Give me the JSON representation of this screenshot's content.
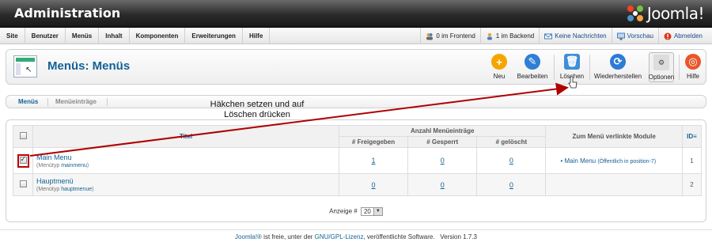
{
  "header": {
    "title": "Administration",
    "brand": "Joomla!"
  },
  "menubar": {
    "items": [
      "Site",
      "Benutzer",
      "Menüs",
      "Inhalt",
      "Komponenten",
      "Erweiterungen",
      "Hilfe"
    ],
    "status": {
      "frontend": "0 im Frontend",
      "backend": "1 im Backend",
      "messages": "Keine Nachrichten",
      "preview": "Vorschau",
      "logout": "Abmelden"
    }
  },
  "toolbar": {
    "page_title": "Menüs: Menüs",
    "buttons": {
      "new": "Neu",
      "edit": "Bearbeiten",
      "delete": "Löschen",
      "restore": "Wiederherstellen",
      "options": "Optionen",
      "help": "Hilfe"
    }
  },
  "submenu": {
    "tab_menus": "Menüs",
    "tab_items": "Menüeinträge"
  },
  "annotation": {
    "line1": "Häkchen setzen und auf",
    "line2": "Löschen drücken"
  },
  "table": {
    "headers": {
      "title": "Titel",
      "count_group": "Anzahl Menüeinträge",
      "published": "# Freigegeben",
      "unpublished": "# Gesperrt",
      "trashed": "# gelöscht",
      "modules": "Zum Menü verlinkte Module",
      "id": "ID"
    },
    "rows": [
      {
        "title": "Main Menu",
        "type_label": "(Menütyp",
        "type": "mainmenu",
        "published": "1",
        "unpublished": "0",
        "trashed": "0",
        "module": "Main Menu",
        "module_detail": "(Öffentlich in position-7)",
        "id": "1",
        "checked": true
      },
      {
        "title": "Hauptmenü",
        "type_label": "(Menütyp",
        "type": "hauptmenue",
        "published": "0",
        "unpublished": "0",
        "trashed": "0",
        "module": "",
        "module_detail": "",
        "id": "2",
        "checked": false
      }
    ],
    "pagination": {
      "label": "Anzeige #",
      "value": "20"
    }
  },
  "footer": {
    "joomla": "Joomla!®",
    "text1": " ist freie, unter der ",
    "license": "GNU/GPL-Lizenz",
    "text2": ", veröffentlichte Software.",
    "version": "Version 1.7.3"
  },
  "colors": {
    "accent": "#146295",
    "annotation_arrow": "#b00000"
  }
}
